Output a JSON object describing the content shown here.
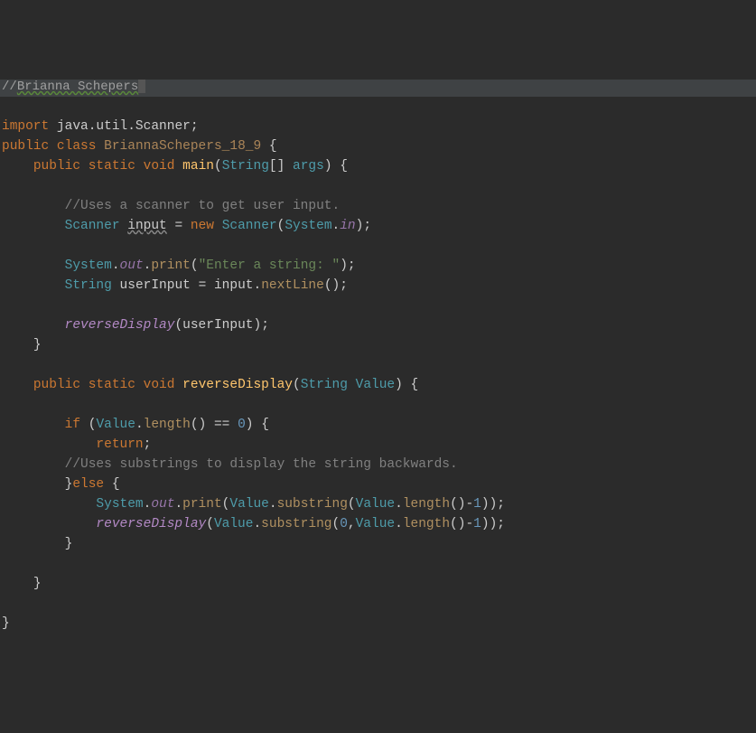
{
  "header": {
    "prefix": "//",
    "name": "Brianna Schepers"
  },
  "t": {
    "import": "import",
    "javaUtilScanner": "java.util.Scanner",
    "semi": ";",
    "public": "public",
    "class_kw": "class",
    "className": "BriannaSchepers_18_9",
    "lbrace": "{",
    "rbrace": "}",
    "static": "static",
    "void": "void",
    "main": "main",
    "lparen": "(",
    "rparen": ")",
    "String": "String",
    "brackets": "[]",
    "args": "args",
    "cmt1": "//Uses a scanner to get user input.",
    "Scanner": "Scanner",
    "input_decl": "input",
    "eq": "=",
    "new": "new",
    "System": "System",
    "dot": ".",
    "in": "in",
    "out": "out",
    "print": "print",
    "promptStr": "\"Enter a string: \"",
    "userInput": "userInput",
    "inputId": "input",
    "nextLine": "nextLine",
    "reverseDisplay": "reverseDisplay",
    "reverseDisplayDecl": "reverseDisplay",
    "Value": "Value",
    "if": "if",
    "length": "length",
    "eqeq": "==",
    "zero": "0",
    "return": "return",
    "cmt2": "//Uses substrings to display the string backwards.",
    "else": "else",
    "substring": "substring",
    "one": "1",
    "minus": "-",
    "comma": ","
  }
}
